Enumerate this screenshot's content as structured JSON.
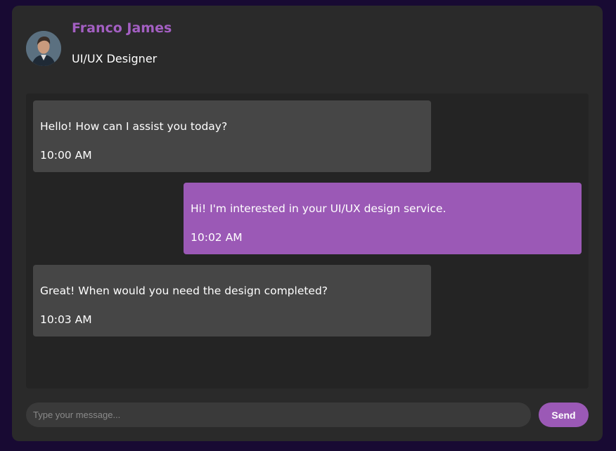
{
  "contact": {
    "name": "Franco James",
    "role": "UI/UX Designer",
    "avatar_icon": "person-avatar-icon"
  },
  "messages": [
    {
      "direction": "received",
      "text": "Hello! How can I assist you today?",
      "time": "10:00 AM"
    },
    {
      "direction": "sent",
      "text": "Hi! I'm interested in your UI/UX design service.",
      "time": "10:02 AM"
    },
    {
      "direction": "received",
      "text": "Great! When would you need the design completed?",
      "time": "10:03 AM"
    }
  ],
  "composer": {
    "placeholder": "Type your message...",
    "value": "",
    "send_label": "Send"
  },
  "colors": {
    "accent": "#9b59b6",
    "name_color": "#a35fc2",
    "received_bubble": "#464646",
    "panel": "#2a2a2a",
    "page_background": "#180a33"
  }
}
